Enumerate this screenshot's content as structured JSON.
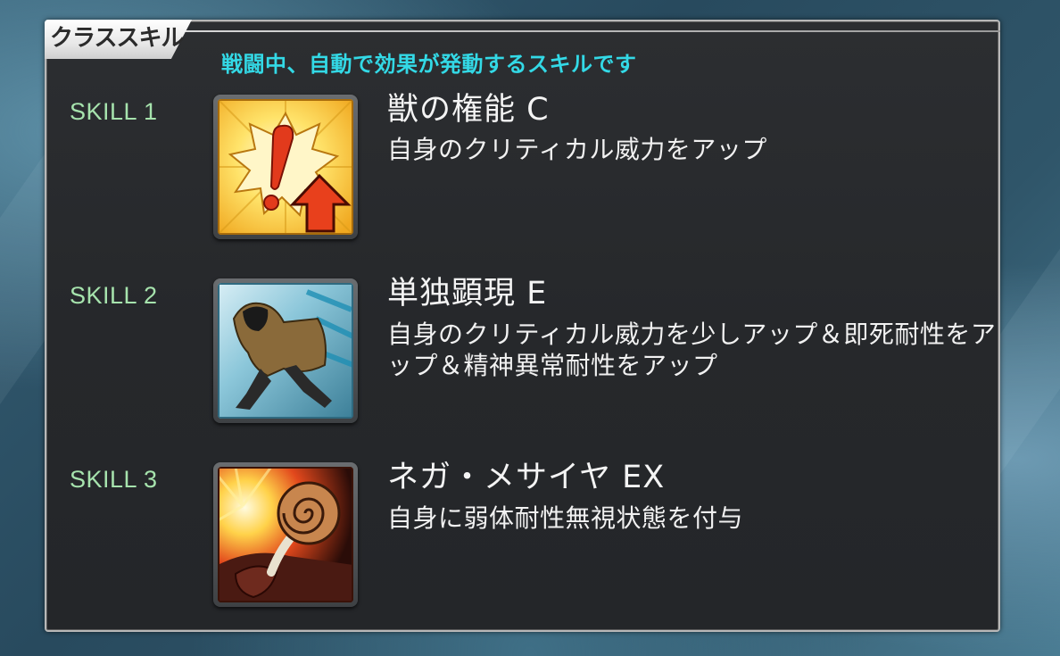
{
  "panel": {
    "tab_title": "クラススキル",
    "subtitle": "戦闘中、自動で効果が発動するスキルです"
  },
  "skills": [
    {
      "label": "SKILL 1",
      "name": "獣の権能 C",
      "description": "自身のクリティカル威力をアップ",
      "icon": "critical-up-icon"
    },
    {
      "label": "SKILL 2",
      "name": "単独顕現 E",
      "description": "自身のクリティカル威力を少しアップ＆即死耐性をアップ＆精神異常耐性をアップ",
      "icon": "hooded-figure-icon"
    },
    {
      "label": "SKILL 3",
      "name": "ネガ・メサイヤ EX",
      "description": "自身に弱体耐性無視状態を付与",
      "icon": "spiral-horn-icon"
    }
  ],
  "colors": {
    "subtitle": "#33d9e6",
    "skill_label": "#a6e3ad",
    "panel_border": "#b8b8b8"
  }
}
